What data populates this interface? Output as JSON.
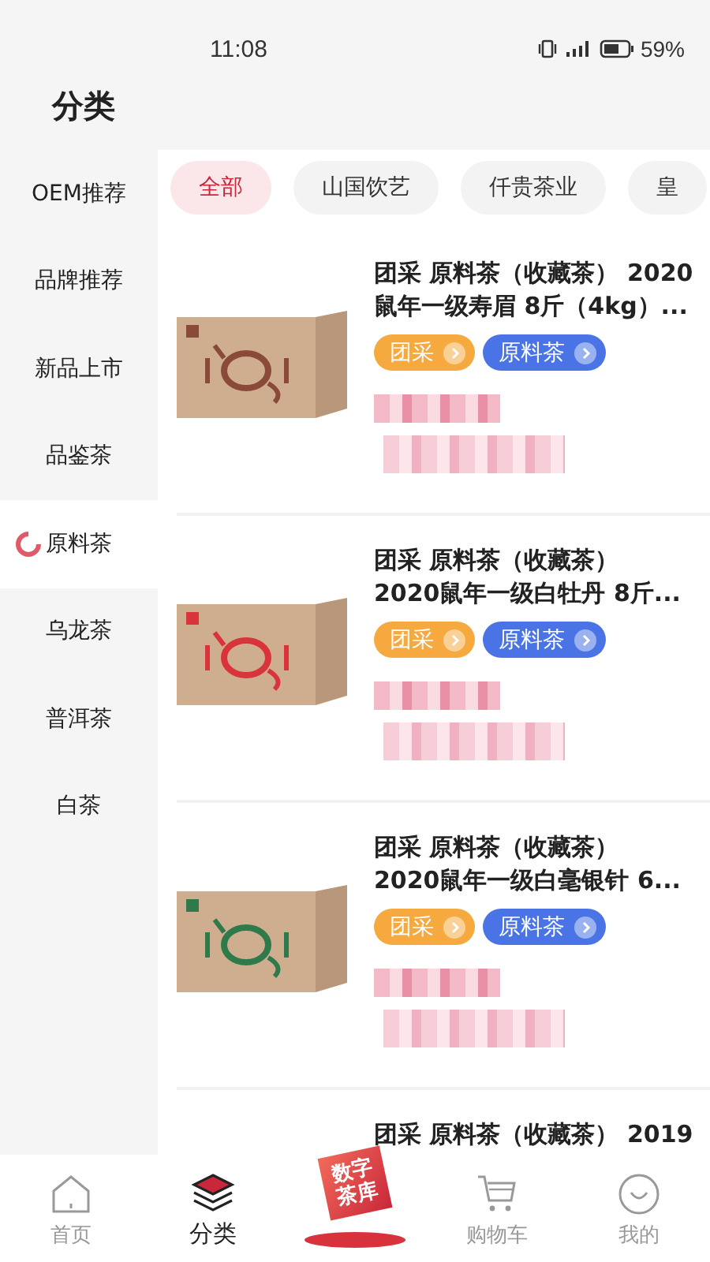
{
  "status_bar": {
    "time": "11:08",
    "battery": "59%"
  },
  "header": {
    "title": "分类"
  },
  "sidebar": {
    "items": [
      {
        "label": "OEM推荐",
        "selected": false
      },
      {
        "label": "品牌推荐",
        "selected": false
      },
      {
        "label": "新品上市",
        "selected": false
      },
      {
        "label": "品鉴茶",
        "selected": false
      },
      {
        "label": "原料茶",
        "selected": true
      },
      {
        "label": "乌龙茶",
        "selected": false
      },
      {
        "label": "普洱茶",
        "selected": false
      },
      {
        "label": "白茶",
        "selected": false
      }
    ]
  },
  "filter_chips": [
    {
      "label": "全部",
      "selected": true
    },
    {
      "label": "山国饮艺",
      "selected": false
    },
    {
      "label": "仟贵茶业",
      "selected": false
    },
    {
      "label": "皇",
      "selected": false
    }
  ],
  "products": [
    {
      "title_lines": [
        "团采 原料茶（收藏茶） 2020",
        "鼠年一级寿眉 8斤（4kg）..."
      ],
      "color": "#8a4a3a",
      "tags": [
        {
          "label": "团采",
          "color": "#f5a93e"
        },
        {
          "label": "原料茶",
          "color": "#4a74e6"
        }
      ]
    },
    {
      "title_lines": [
        "团采 原料茶（收藏茶）",
        "2020鼠年一级白牡丹 8斤..."
      ],
      "color": "#d9343c",
      "tags": [
        {
          "label": "团采",
          "color": "#f5a93e"
        },
        {
          "label": "原料茶",
          "color": "#4a74e6"
        }
      ]
    },
    {
      "title_lines": [
        "团采 原料茶（收藏茶）",
        "2020鼠年一级白毫银针 6..."
      ],
      "color": "#2f7a4a",
      "tags": [
        {
          "label": "团采",
          "color": "#f5a93e"
        },
        {
          "label": "原料茶",
          "color": "#4a74e6"
        }
      ]
    },
    {
      "title_lines": [
        "团采 原料茶（收藏茶） 2019"
      ]
    }
  ],
  "bottom_nav": [
    {
      "kind": "home",
      "label": "首页",
      "selected": false
    },
    {
      "kind": "category",
      "label": "分类",
      "selected": true
    },
    {
      "kind": "featured",
      "label": "数字茶库"
    },
    {
      "kind": "cart",
      "label": "购物车",
      "selected": false
    },
    {
      "kind": "profile",
      "label": "我的",
      "selected": false
    }
  ]
}
